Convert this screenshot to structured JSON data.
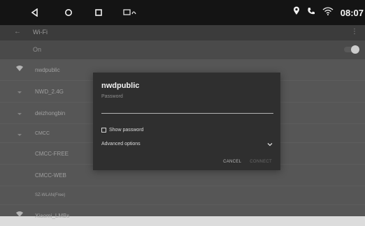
{
  "status_bar": {
    "time": "08:07",
    "nav_icons": [
      "back-triangle-icon",
      "home-circle-icon",
      "recents-square-icon",
      "screenshot-icon"
    ],
    "status_icons": [
      "location-pin-icon",
      "phone-icon",
      "wifi-icon"
    ]
  },
  "toolbar": {
    "title": "Wi-Fi"
  },
  "wifi_toggle": {
    "label": "On",
    "state": "on"
  },
  "networks": [
    {
      "ssid": "nwdpublic",
      "icon": "wifi-signal-icon"
    },
    {
      "ssid": "NWD_2.4G",
      "icon": "wifi-lock-icon"
    },
    {
      "ssid": "deizhongbin",
      "icon": "wifi-lock-icon"
    },
    {
      "ssid": "CMCC",
      "icon": "wifi-lock-icon"
    },
    {
      "ssid": "CMCC-FREE",
      "icon": "none"
    },
    {
      "ssid": "CMCC-WEB",
      "icon": "none"
    },
    {
      "ssid": "SZ-WLAN(Free)",
      "icon": "none"
    },
    {
      "ssid": "Xiaomi_LMBs",
      "icon": "wifi-signal-icon"
    }
  ],
  "dialog": {
    "title": "nwdpublic",
    "password_label": "Password",
    "password_value": "",
    "show_password_label": "Show password",
    "show_password_checked": false,
    "advanced_label": "Advanced options",
    "cancel_label": "CANCEL",
    "connect_label": "CONNECT"
  },
  "colors": {
    "statusbar_bg": "#141414",
    "toolbar_bg": "#3b3b3b",
    "list_bg": "#5b5b5b",
    "dialog_bg": "#2f2f2f"
  }
}
